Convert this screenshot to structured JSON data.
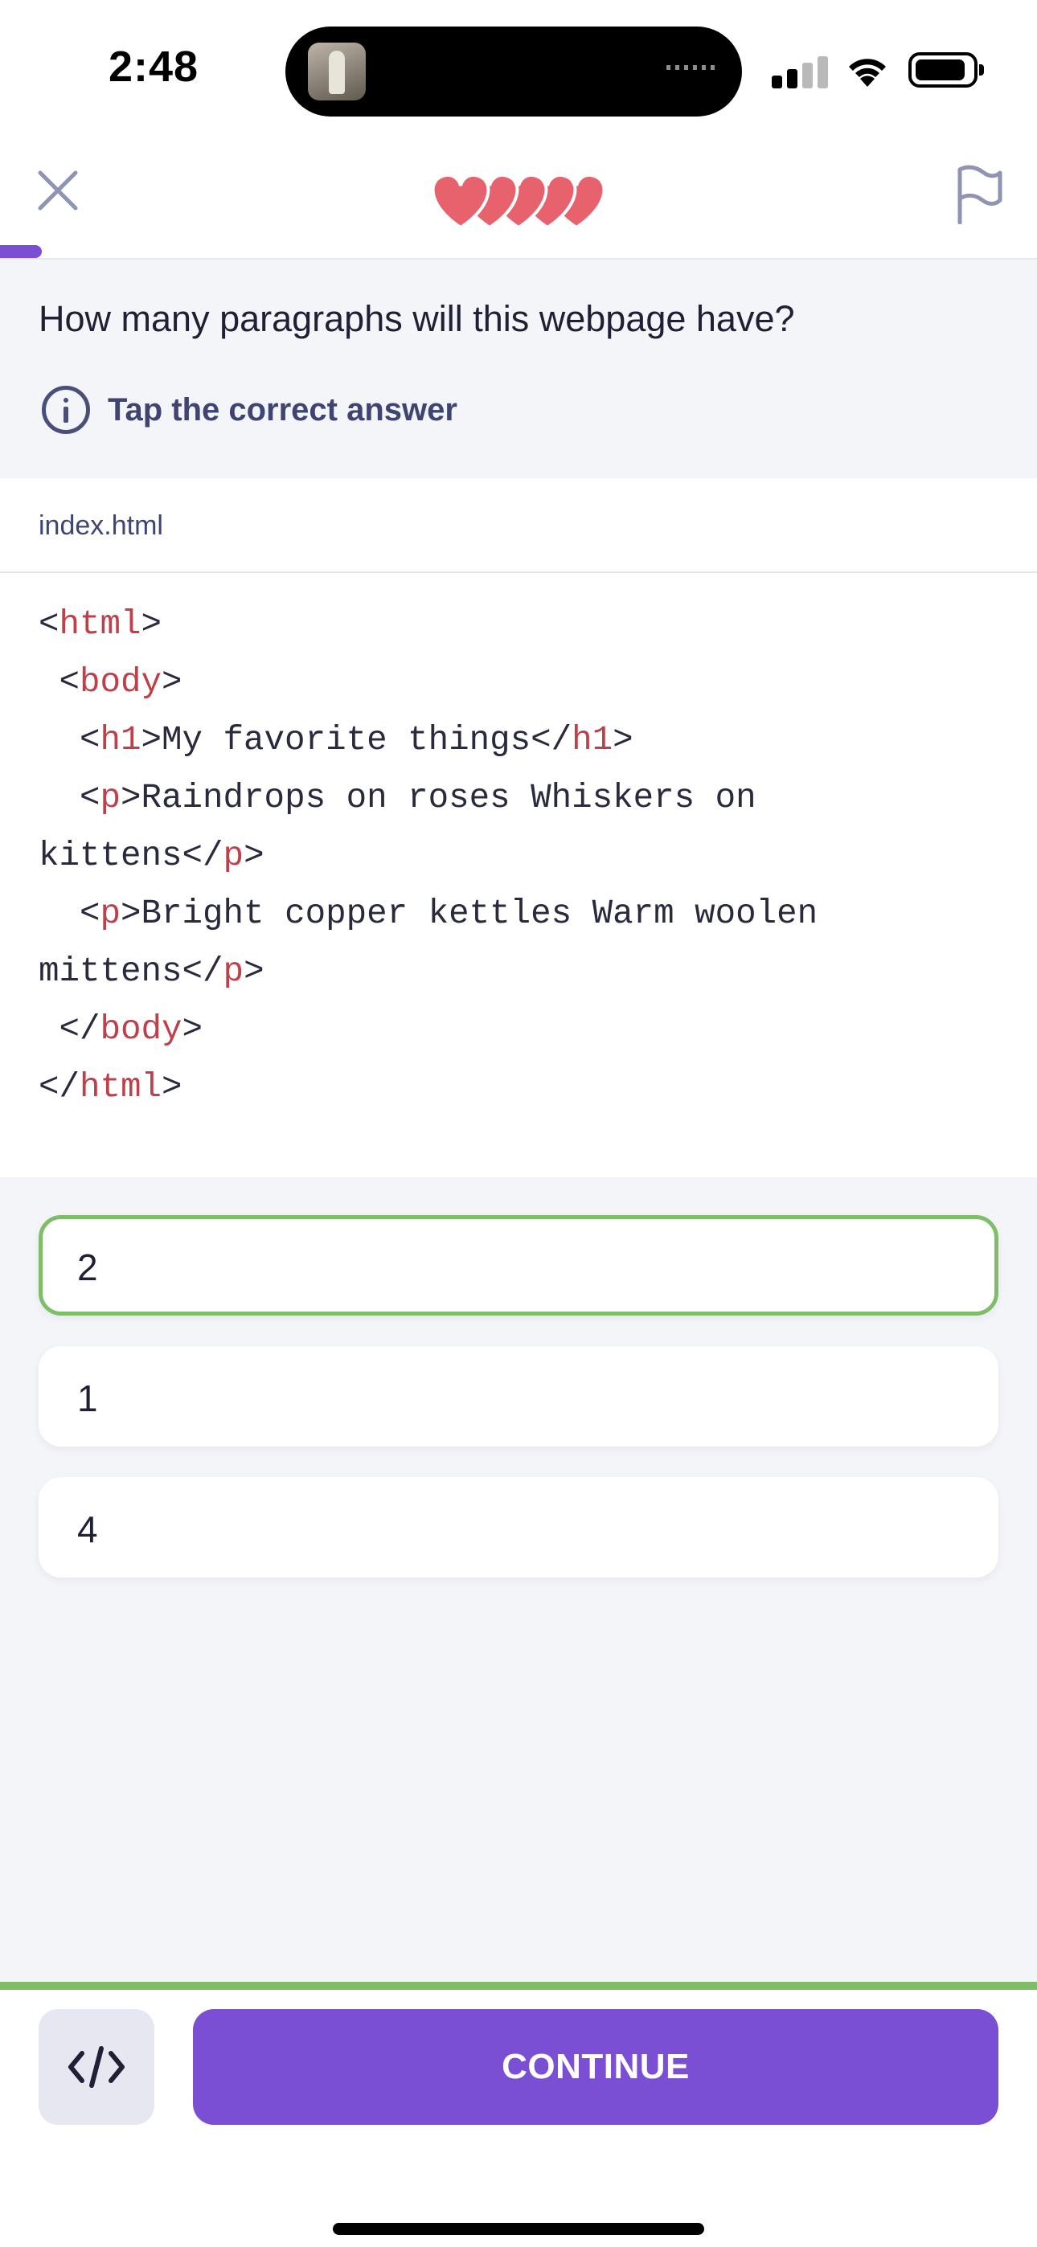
{
  "status_bar": {
    "time": "2:48"
  },
  "header": {
    "close_icon": "close-icon",
    "hearts_count": 5,
    "heart_color": "#e8626e",
    "flag_icon": "flag-icon",
    "progress_fraction": 0.04
  },
  "question": {
    "text": "How many paragraphs will this webpage have?",
    "hint": "Tap the correct answer",
    "hint_icon": "info-icon"
  },
  "code": {
    "file_name": "index.html",
    "lines": [
      [
        {
          "t": "<"
        },
        {
          "t": "html",
          "tag": true
        },
        {
          "t": ">"
        }
      ],
      [
        {
          "t": " <"
        },
        {
          "t": "body",
          "tag": true
        },
        {
          "t": ">"
        }
      ],
      [
        {
          "t": "  <"
        },
        {
          "t": "h1",
          "tag": true
        },
        {
          "t": ">My favorite things</"
        },
        {
          "t": "h1",
          "tag": true
        },
        {
          "t": ">"
        }
      ],
      [
        {
          "t": "  <"
        },
        {
          "t": "p",
          "tag": true
        },
        {
          "t": ">Raindrops on roses Whiskers on"
        }
      ],
      [
        {
          "t": "kittens</"
        },
        {
          "t": "p",
          "tag": true
        },
        {
          "t": ">"
        }
      ],
      [
        {
          "t": "  <"
        },
        {
          "t": "p",
          "tag": true
        },
        {
          "t": ">Bright copper kettles Warm woolen"
        }
      ],
      [
        {
          "t": "mittens</"
        },
        {
          "t": "p",
          "tag": true
        },
        {
          "t": ">"
        }
      ],
      [
        {
          "t": " </"
        },
        {
          "t": "body",
          "tag": true
        },
        {
          "t": ">"
        }
      ],
      [
        {
          "t": "</"
        },
        {
          "t": "html",
          "tag": true
        },
        {
          "t": ">"
        }
      ]
    ]
  },
  "options": [
    {
      "label": "2",
      "selected": true
    },
    {
      "label": "1",
      "selected": false
    },
    {
      "label": "4",
      "selected": false
    }
  ],
  "footer": {
    "code_toggle_icon": "code-icon",
    "continue_label": "CONTINUE"
  },
  "colors": {
    "accent": "#7a4fd4",
    "correct": "#7fbd68",
    "tag": "#c0404a"
  }
}
